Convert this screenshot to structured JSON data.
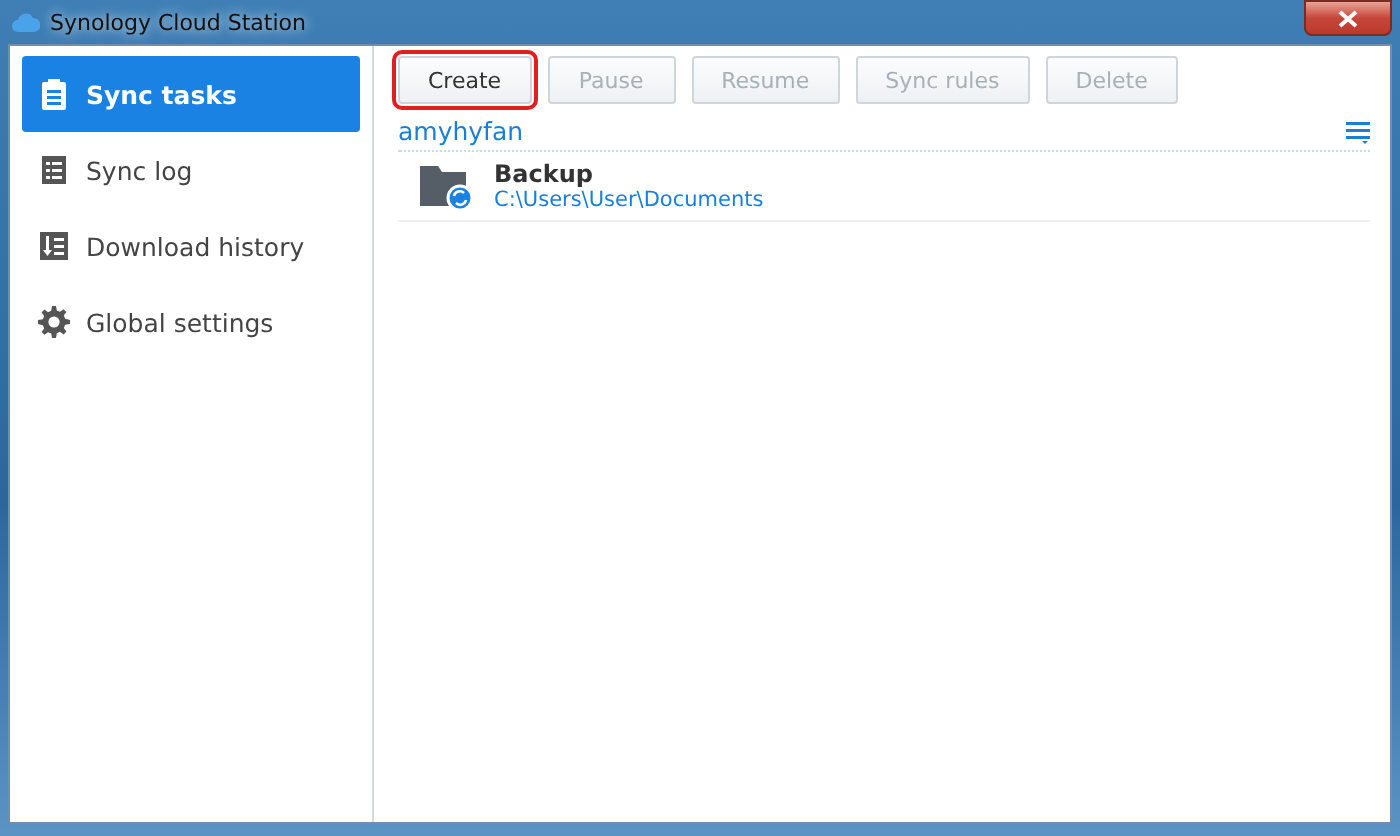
{
  "window": {
    "title": "Synology Cloud Station"
  },
  "sidebar": {
    "items": [
      {
        "label": "Sync tasks",
        "selected": true
      },
      {
        "label": "Sync log",
        "selected": false
      },
      {
        "label": "Download history",
        "selected": false
      },
      {
        "label": "Global settings",
        "selected": false
      }
    ]
  },
  "toolbar": {
    "buttons": [
      {
        "label": "Create",
        "disabled": false,
        "highlighted": true
      },
      {
        "label": "Pause",
        "disabled": true,
        "highlighted": false
      },
      {
        "label": "Resume",
        "disabled": true,
        "highlighted": false
      },
      {
        "label": "Sync rules",
        "disabled": true,
        "highlighted": false
      },
      {
        "label": "Delete",
        "disabled": true,
        "highlighted": false
      }
    ]
  },
  "account": {
    "name": "amyhyfan"
  },
  "tasks": [
    {
      "name": "Backup",
      "path": "C:\\Users\\User\\Documents"
    }
  ]
}
